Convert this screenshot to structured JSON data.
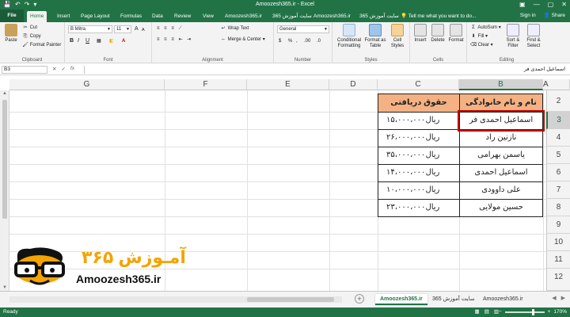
{
  "titlebar": {
    "title": "Amoozesh365.ir - Excel",
    "qat_save": "💾",
    "qat_undo": "↶",
    "qat_redo": "↷",
    "qat_more": "▾",
    "min": "—",
    "max": "▢",
    "close": "✕",
    "ribbon_opts": "▣"
  },
  "tabs": {
    "file": "File",
    "items": [
      "Home",
      "Insert",
      "Page Layout",
      "Formulas",
      "Data",
      "Review",
      "View",
      "Amoozesh365.ir",
      "سایت آموزش 365",
      "Amoozesh365.ir",
      "سایت آموزش 365"
    ],
    "tell_me": "Tell me what you want to do...",
    "sign_in": "Sign in",
    "share": "Share"
  },
  "ribbon": {
    "clipboard": {
      "label": "Clipboard",
      "paste": "Paste",
      "cut": "Cut",
      "copy": "Copy",
      "format_painter": "Format Painter"
    },
    "font": {
      "label": "Font",
      "name": "B Mitra",
      "size": "11",
      "bold": "B",
      "italic": "I",
      "underline": "U",
      "grow": "A",
      "shrink": "A"
    },
    "alignment": {
      "label": "Alignment",
      "wrap_text": "Wrap Text",
      "merge_center": "Merge & Center"
    },
    "number": {
      "label": "Number",
      "format": "General",
      "currency": "$",
      "percent": "%",
      "comma": ",",
      "inc_dec": ".00",
      "dec_dec": ".0"
    },
    "styles": {
      "label": "Styles",
      "conditional": "Conditional Formatting",
      "format_table": "Format as Table",
      "cell_styles": "Cell Styles"
    },
    "cells": {
      "label": "Cells",
      "insert": "Insert",
      "delete": "Delete",
      "format": "Format"
    },
    "editing": {
      "label": "Editing",
      "autosum": "AutoSum",
      "fill": "Fill",
      "clear": "Clear",
      "sort_filter": "Sort & Filter",
      "find_select": "Find & Select"
    }
  },
  "formula_bar": {
    "name_box": "B3",
    "cancel": "✕",
    "enter": "✓",
    "fx": "fx",
    "content": "اسماعیل احمدی فر"
  },
  "grid": {
    "columns": [
      "G",
      "F",
      "E",
      "D",
      "C",
      "B",
      "A"
    ],
    "selected_column": "B",
    "rows": [
      "2",
      "3",
      "4",
      "5",
      "6",
      "7",
      "8",
      "9",
      "10",
      "11",
      "12"
    ],
    "selected_row": "3"
  },
  "table": {
    "headers": {
      "name": "نام و نام خانوادگی",
      "salary": "حقوق دریافتی"
    },
    "rows": [
      {
        "name": "اسماعیل احمدی فر",
        "salary": "۱۵،۰۰۰،۰۰۰ریال"
      },
      {
        "name": "نازنین راد",
        "salary": "۲۶،۰۰۰،۰۰۰ریال"
      },
      {
        "name": "یاسمن بهرامی",
        "salary": "۳۵،۰۰۰،۰۰۰ریال"
      },
      {
        "name": "اسماعیل احمدی",
        "salary": "۱۴،۰۰۰،۰۰۰ریال"
      },
      {
        "name": "علی داوودی",
        "salary": "۱۰،۰۰۰،۰۰۰ریال"
      },
      {
        "name": "حسین مولایی",
        "salary": "۲۳،۰۰۰،۰۰۰ریال"
      }
    ]
  },
  "logo": {
    "text": "Amoozesh365.ir",
    "fa_text": "آمـوزش ۳۶۵"
  },
  "sheets": {
    "tabs": [
      "Amoozesh365.ir",
      "سایت آموزش 365",
      "Amoozesh365.ir"
    ],
    "active": 0,
    "add": "+",
    "prev": "◀",
    "next": "▶"
  },
  "status": {
    "ready": "Ready",
    "zoom": "170%",
    "zoom_out": "−",
    "zoom_in": "+"
  },
  "colors": {
    "accent": "#217346",
    "header_fill": "#f4b183",
    "selection": "#c00000",
    "logo_orange": "#f5a300"
  }
}
